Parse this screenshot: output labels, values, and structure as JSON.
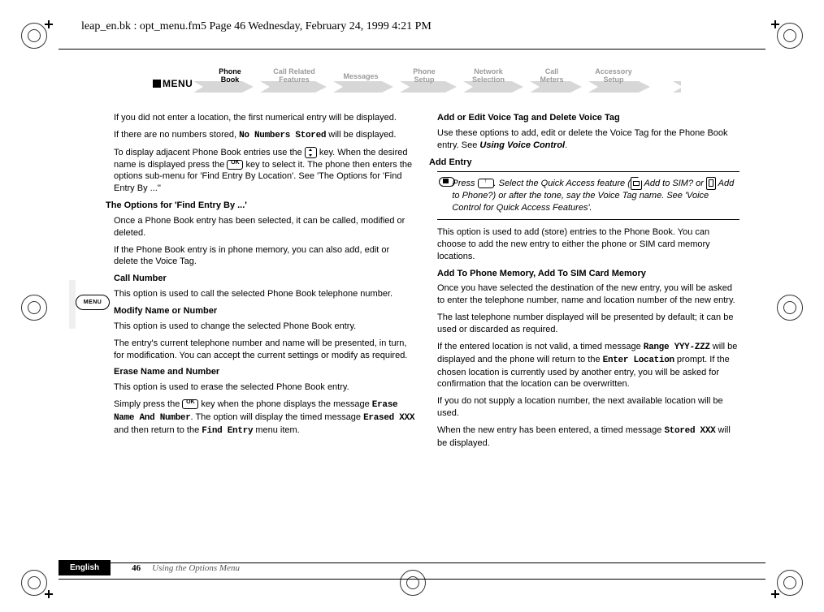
{
  "header": "leap_en.bk : opt_menu.fm5  Page 46  Wednesday, February 24, 1999  4:21 PM",
  "menu_label": "MENU",
  "tabs": {
    "phone_book": {
      "l1": "Phone",
      "l2": "Book"
    },
    "call_related": {
      "l1": "Call Related",
      "l2": "Features"
    },
    "messages": {
      "l1": "Messages"
    },
    "phone_setup": {
      "l1": "Phone",
      "l2": "Setup"
    },
    "network": {
      "l1": "Network",
      "l2": "Selection"
    },
    "call_meters": {
      "l1": "Call",
      "l2": "Meters"
    },
    "accessory": {
      "l1": "Accessory",
      "l2": "Setup"
    }
  },
  "left": {
    "p1": "If you did not enter a location, the first numerical entry will be displayed.",
    "p2a": "If there are no numbers stored, ",
    "p2mono": "No Numbers Stored",
    "p2b": " will be displayed.",
    "p3a": "To display adjacent Phone Book entries use the ",
    "p3b": " key. When the desired name is displayed press the ",
    "p3c": " key to select it. The phone then enters the options sub-menu for 'Find Entry By Location'. See 'The Options for 'Find Entry By ...''",
    "h1": "The Options for 'Find Entry By ...'",
    "p4": "Once a Phone Book entry has been selected, it can be called, modified or deleted.",
    "p5": "If the Phone Book entry is in phone memory, you can also add, edit or delete the Voice Tag.",
    "h2": "Call Number",
    "p6": "This option is used to call the selected Phone Book telephone number.",
    "h3": "Modify Name or Number",
    "p7": "This option is used to change the selected Phone Book entry.",
    "p8": "The entry's current telephone number and name will be presented, in turn, for modification. You can accept the current settings or modify as required.",
    "h4": "Erase Name and Number",
    "p9": "This option is used to erase the selected Phone Book entry.",
    "p10a": "Simply press the ",
    "p10b": " key when the phone displays the message ",
    "p10mono1": "Erase Name And Number",
    "p10c": ". The option will display the timed message ",
    "p10mono2": "Erased XXX",
    "p10d": " and then return to the ",
    "p10mono3": "Find Entry",
    "p10e": " menu item."
  },
  "right": {
    "h1": "Add or Edit Voice Tag and Delete Voice Tag",
    "p1a": "Use these options to add, edit or delete the Voice Tag for the Phone Book entry. See ",
    "p1b": "Using Voice Control",
    "p1c": ".",
    "h2": "Add Entry",
    "note_a": "Press ",
    "note_b": ". Select the Quick Access feature (",
    "note_c": " Add to SIM? or ",
    "note_d": " Add to Phone?) or after the tone, say the Voice Tag name. See 'Voice Control for Quick Access Features'.",
    "p2": "This option is used to add (store) entries to the Phone Book. You can choose to add the new entry to either the phone or SIM card memory locations.",
    "h3": "Add To Phone Memory, Add To SIM Card Memory",
    "p3": "Once you have selected the destination of the new entry, you will be asked to enter the telephone number, name and location number of the new entry.",
    "p4": "The last telephone number displayed will be presented by default; it can be used or discarded as required.",
    "p5a": "If the entered location is not valid, a timed message ",
    "p5mono1": "Range YYY-ZZZ",
    "p5b": " will be displayed and the phone will return to the ",
    "p5mono2": "Enter Location",
    "p5c": " prompt. If the chosen location is currently used by another entry, you will be asked for confirmation that the location can be overwritten.",
    "p6": "If you do not supply a location number, the next available location will be used.",
    "p7a": "When the new entry has been entered, a timed message ",
    "p7mono": "Stored XXX",
    "p7b": " will be displayed."
  },
  "side_pill": "MENU",
  "footer": {
    "lang": "English",
    "page": "46",
    "section": "Using the Options Menu"
  },
  "ok_label": "OK",
  "up_label": "↑"
}
